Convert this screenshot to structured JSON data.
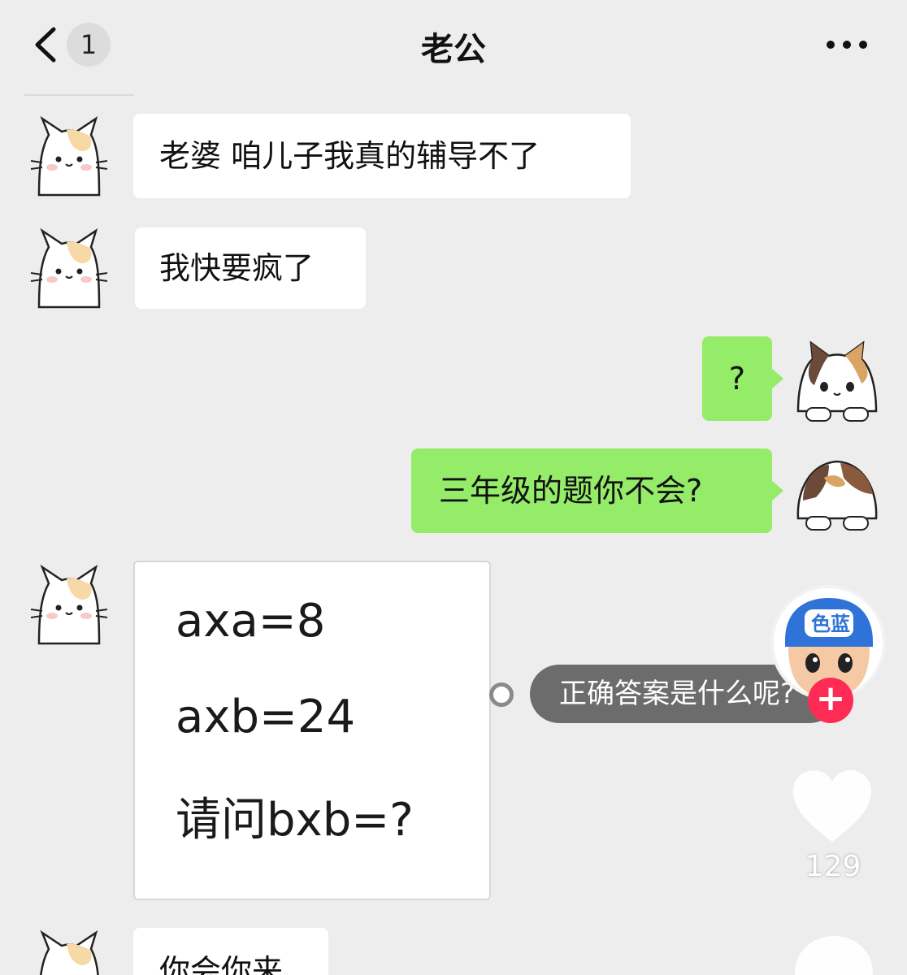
{
  "header": {
    "unread_count": "1",
    "title": "老公"
  },
  "messages": {
    "m1": "老婆 咱儿子我真的辅导不了",
    "m2": "我快要疯了",
    "m3": "?",
    "m4": "三年级的题你不会?",
    "m5": {
      "line1": "axa=8",
      "line2": "axb=24",
      "line3": "请问bxb=?"
    },
    "m6": "你会你来"
  },
  "overlay": {
    "comment_text": "正确答案是什么呢?",
    "creator_badge_text": "色蓝",
    "follow_symbol": "+",
    "like_count": "129"
  },
  "colors": {
    "background": "#ededed",
    "incoming_bubble": "#ffffff",
    "outgoing_bubble": "#95ec69",
    "follow_button": "#fe2c55"
  },
  "icons": {
    "back": "chevron-left-icon",
    "more": "more-dots-icon",
    "like": "heart-icon",
    "follow": "plus-icon",
    "comment_marker": "ring-dot-icon"
  }
}
